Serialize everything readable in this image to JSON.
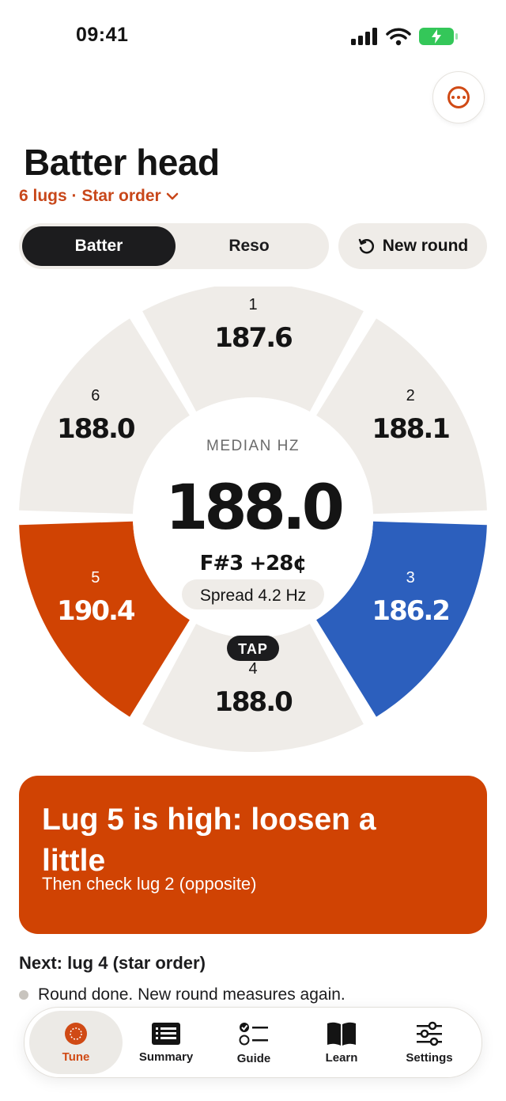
{
  "status": {
    "time": "09:41"
  },
  "header": {
    "title": "Batter head",
    "subtitle": "6 lugs · Star order"
  },
  "segment": {
    "options": [
      "Batter",
      "Reso"
    ],
    "selected": "Batter"
  },
  "new_round_label": "New round",
  "dial": {
    "center_label": "MEDIAN HZ",
    "median": "188.0",
    "note": "F#3 +28¢",
    "spread": "Spread 4.2 Hz",
    "tap_label": "TAP",
    "lugs": [
      {
        "num": "1",
        "hz": "187.6",
        "state": "neutral"
      },
      {
        "num": "2",
        "hz": "188.1",
        "state": "neutral"
      },
      {
        "num": "3",
        "hz": "186.2",
        "state": "low"
      },
      {
        "num": "4",
        "hz": "188.0",
        "state": "neutral"
      },
      {
        "num": "5",
        "hz": "190.4",
        "state": "high"
      },
      {
        "num": "6",
        "hz": "188.0",
        "state": "neutral"
      }
    ],
    "colors": {
      "neutral": "#efece8",
      "high": "#d04303",
      "low": "#2c5fbd"
    }
  },
  "instruction": {
    "headline": "Lug 5 is high: loosen a little",
    "sub": "Then check lug 2 (opposite)"
  },
  "next": "Next: lug 4 (star order)",
  "round_note": "Round done. New round measures again.",
  "tabs": [
    {
      "label": "Tune",
      "icon": "tune-dial-icon",
      "active": true
    },
    {
      "label": "Summary",
      "icon": "list-icon",
      "active": false
    },
    {
      "label": "Guide",
      "icon": "checklist-icon",
      "active": false
    },
    {
      "label": "Learn",
      "icon": "book-icon",
      "active": false
    },
    {
      "label": "Settings",
      "icon": "sliders-icon",
      "active": false
    }
  ],
  "accent": "#d04a15"
}
